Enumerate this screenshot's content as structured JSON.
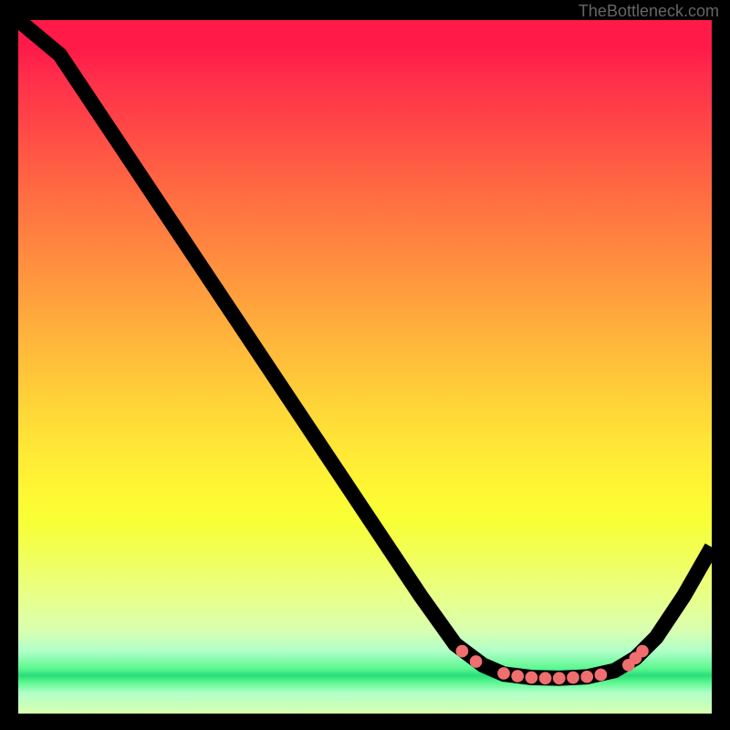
{
  "attribution": "TheBottleneck.com",
  "chart_data": {
    "type": "line",
    "title": "",
    "xlabel": "",
    "ylabel": "",
    "xlim": [
      0,
      100
    ],
    "ylim": [
      0,
      100
    ],
    "curve": [
      {
        "x": 0,
        "y": 100
      },
      {
        "x": 6,
        "y": 95
      },
      {
        "x": 12,
        "y": 86
      },
      {
        "x": 20,
        "y": 74
      },
      {
        "x": 30,
        "y": 59
      },
      {
        "x": 40,
        "y": 44
      },
      {
        "x": 50,
        "y": 29
      },
      {
        "x": 58,
        "y": 17
      },
      {
        "x": 63,
        "y": 10
      },
      {
        "x": 67,
        "y": 7
      },
      {
        "x": 70,
        "y": 5.7
      },
      {
        "x": 74,
        "y": 5.2
      },
      {
        "x": 78,
        "y": 5.1
      },
      {
        "x": 82,
        "y": 5.3
      },
      {
        "x": 86,
        "y": 6.2
      },
      {
        "x": 89,
        "y": 8
      },
      {
        "x": 92,
        "y": 11
      },
      {
        "x": 96,
        "y": 17
      },
      {
        "x": 100,
        "y": 24
      }
    ],
    "markers": [
      {
        "x": 64,
        "y": 9.0
      },
      {
        "x": 66,
        "y": 7.5
      },
      {
        "x": 70,
        "y": 5.8
      },
      {
        "x": 72,
        "y": 5.4
      },
      {
        "x": 74,
        "y": 5.2
      },
      {
        "x": 76,
        "y": 5.1
      },
      {
        "x": 78,
        "y": 5.1
      },
      {
        "x": 80,
        "y": 5.2
      },
      {
        "x": 82,
        "y": 5.3
      },
      {
        "x": 84,
        "y": 5.6
      },
      {
        "x": 88,
        "y": 7.0
      },
      {
        "x": 89,
        "y": 8.0
      },
      {
        "x": 90,
        "y": 9.0
      }
    ],
    "marker_color": "#ef6e6e"
  }
}
